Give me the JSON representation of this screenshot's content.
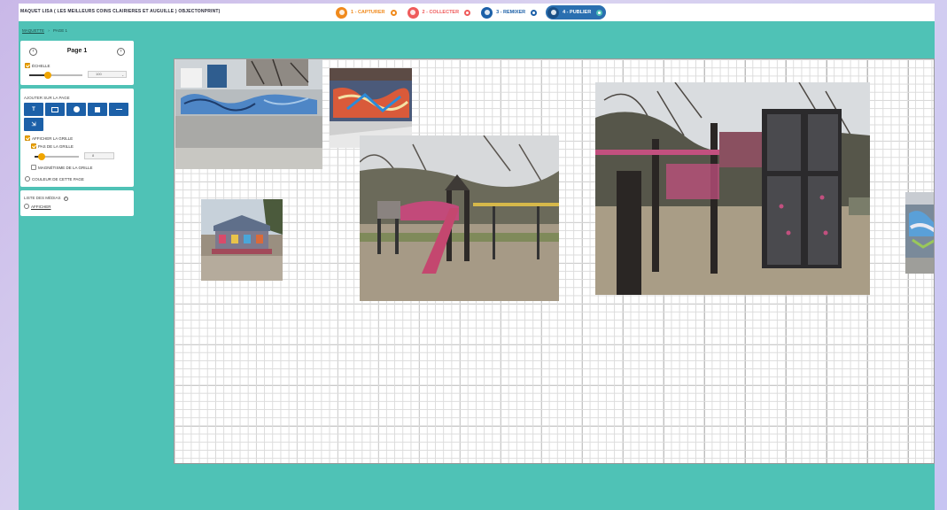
{
  "app": {
    "title": "MAQUET LISA ( LES MEILLEURS COINS CLAIRIERES ET AUGUILLE ) OBJECTONPRINT)",
    "steps": [
      {
        "label": "1 - CAPTURER",
        "color": "#f08a1c",
        "active": false
      },
      {
        "label": "2 - COLLECTER",
        "color": "#ef5b5b",
        "active": false
      },
      {
        "label": "3 - REMIXER",
        "color": "#1c60a8",
        "active": false
      },
      {
        "label": "4 - PUBLIER",
        "color": "#2a6fb0",
        "active": true
      }
    ]
  },
  "breadcrumb": [
    "MAQUETTE",
    "PAGE 1"
  ],
  "page_panel": {
    "title": "Page 1",
    "prev_icon": "chevron-left-icon",
    "next_icon": "chevron-right-icon",
    "echelle_label": "ÉCHELLE",
    "echelle_value": "100",
    "echelle_fraction": 0.35
  },
  "add_panel": {
    "title": "AJOUTER SUR LA PAGE",
    "tools": [
      {
        "name": "text-tool",
        "glyph": "T"
      },
      {
        "name": "image-tool",
        "glyph": ""
      },
      {
        "name": "circle-tool",
        "glyph": ""
      },
      {
        "name": "square-tool",
        "glyph": ""
      },
      {
        "name": "line-tool",
        "glyph": ""
      },
      {
        "name": "export-tool",
        "glyph": "⇲"
      }
    ],
    "show_grid_label": "AFFICHER LA GRILLE",
    "grid_step_label": "PAS DE LA GRILLE",
    "grid_step_value": "8",
    "grid_step_fraction": 0.15,
    "snap_label": "MAGNÉTISME DE LA GRILLE",
    "page_color_label": "COULEUR DE CETTE PAGE"
  },
  "media_panel": {
    "title": "LISTE DES MÉDIAS",
    "option": "AFFICHER"
  }
}
